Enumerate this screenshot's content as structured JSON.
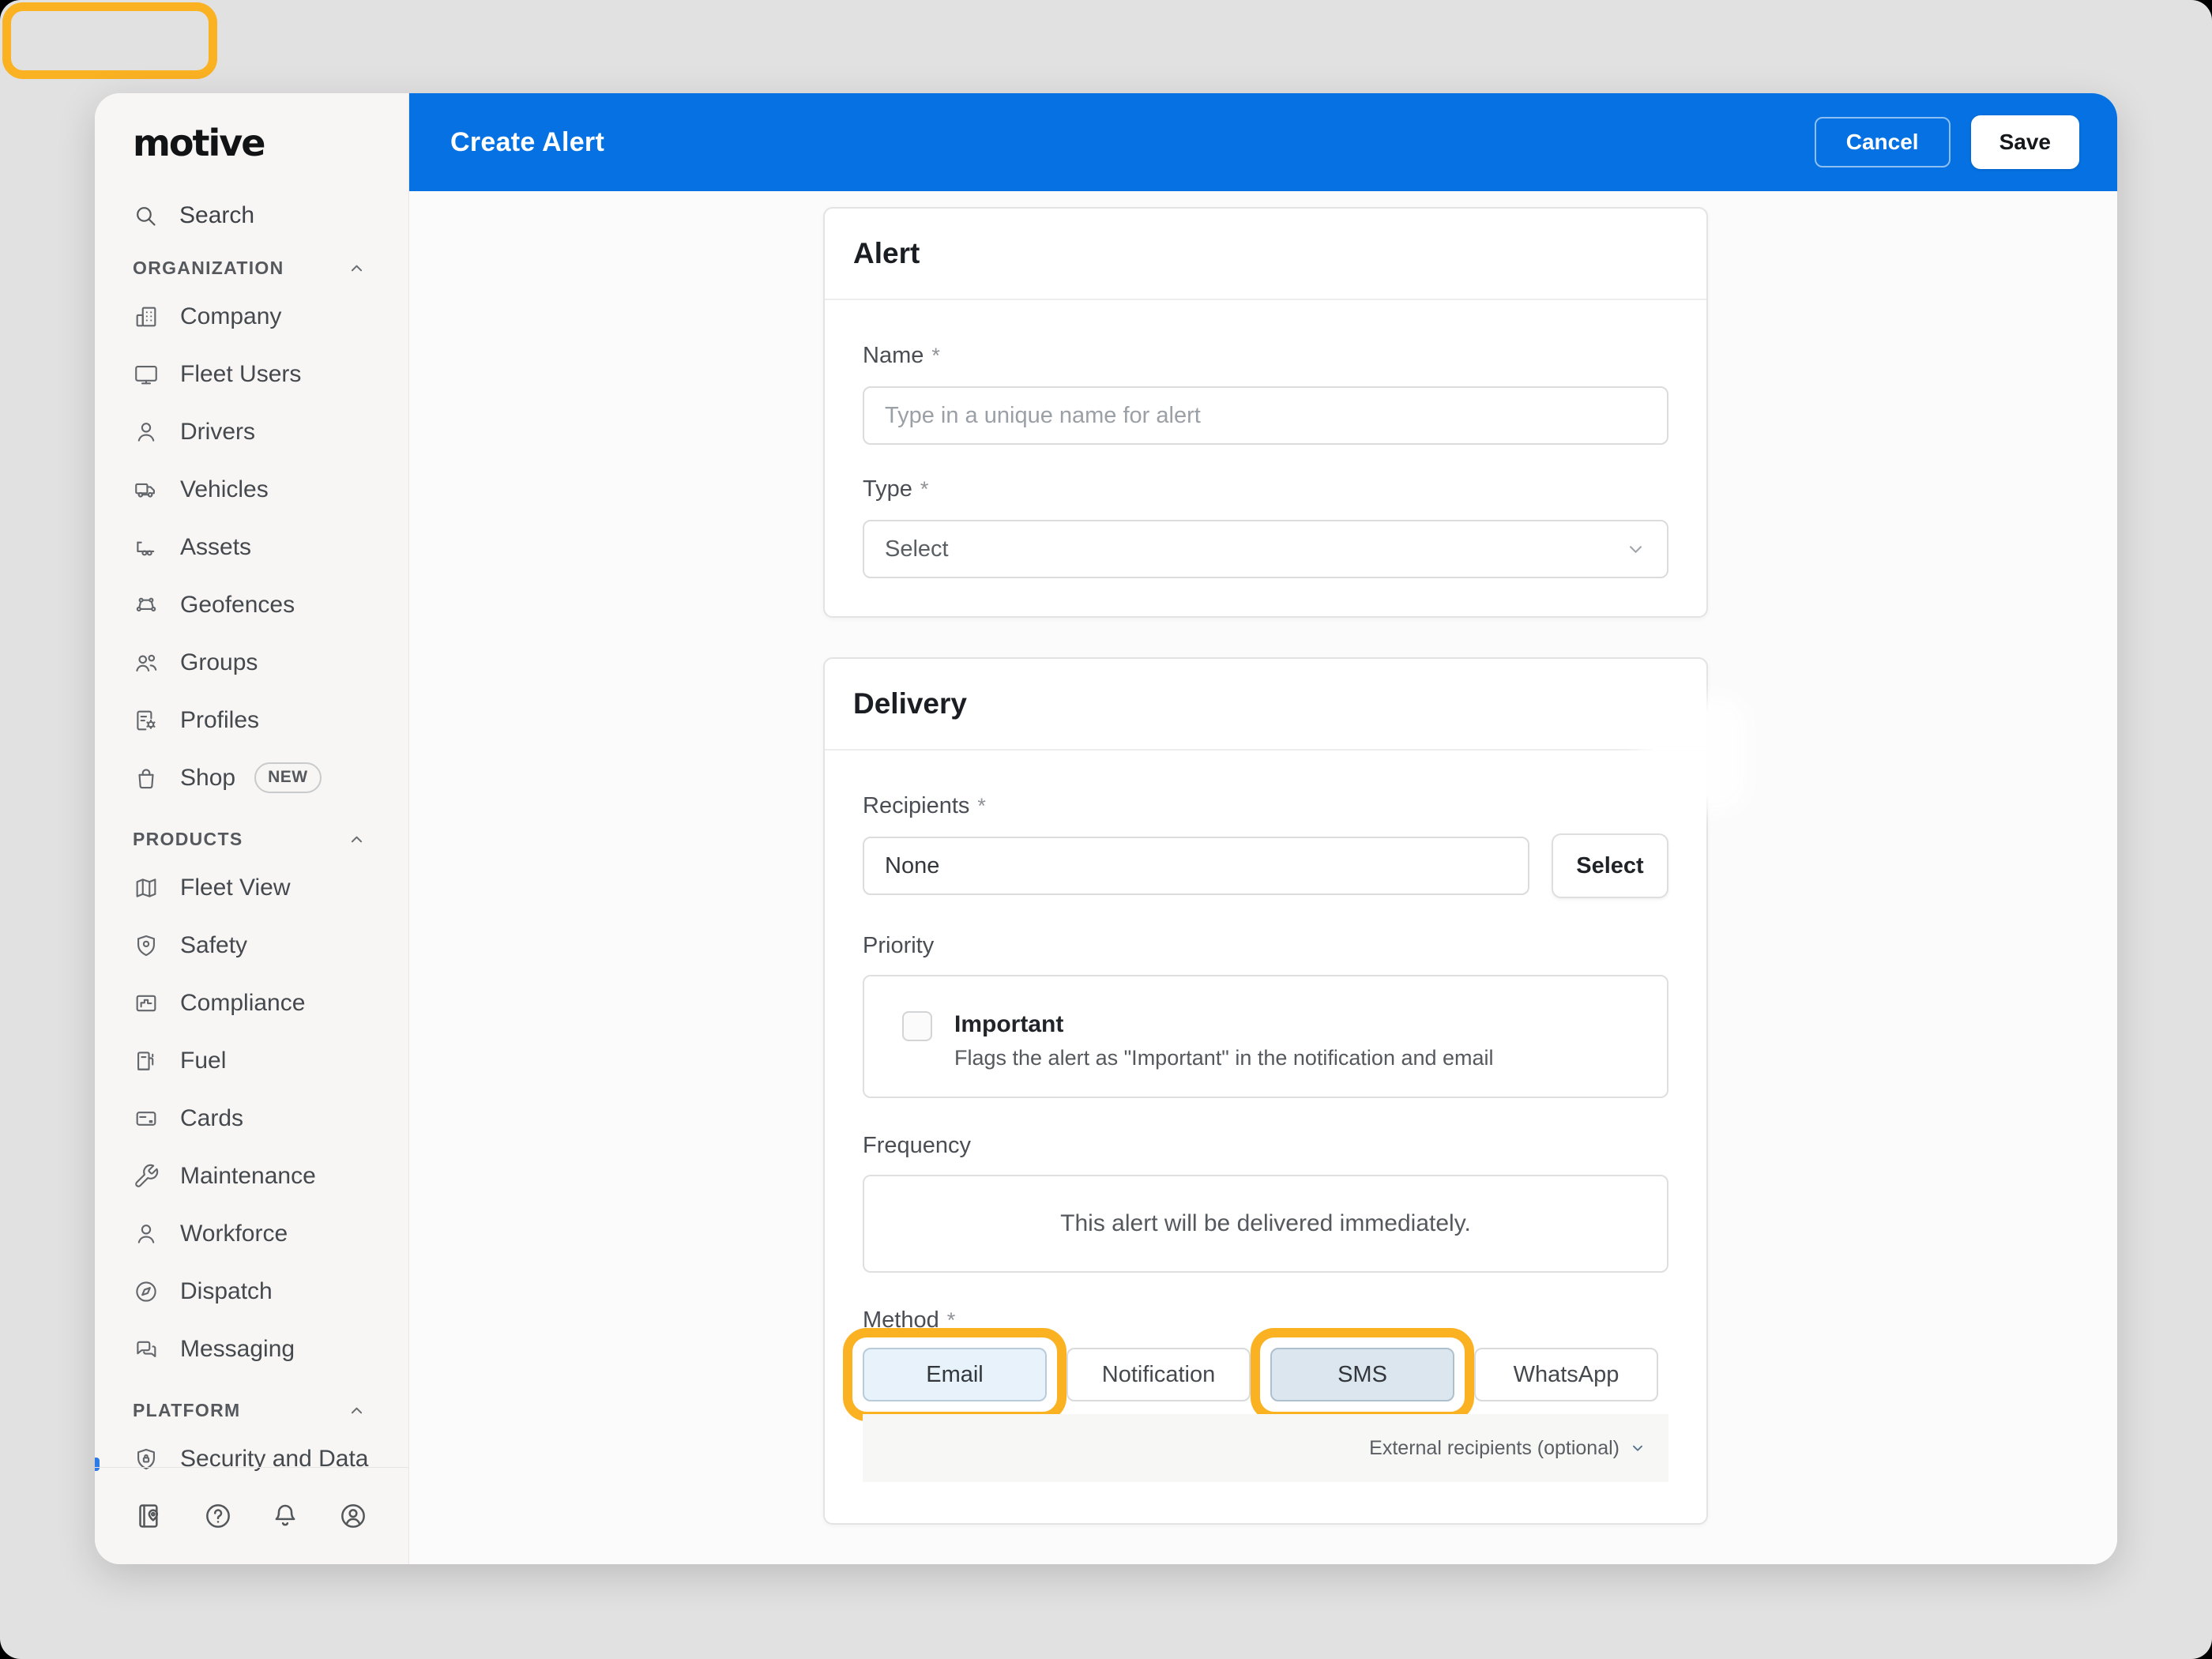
{
  "colors": {
    "header_blue": "#0571E2",
    "highlight_yellow": "#FAB122",
    "method_email_bg": "#E8F2FB",
    "method_sms_bg": "#DCE6EE"
  },
  "sidebar": {
    "logo_text": "motive",
    "search_label": "Search",
    "sections": [
      {
        "label": "ORGANIZATION",
        "items": [
          {
            "label": "Company",
            "icon": "building"
          },
          {
            "label": "Fleet Users",
            "icon": "monitor"
          },
          {
            "label": "Drivers",
            "icon": "person"
          },
          {
            "label": "Vehicles",
            "icon": "truck"
          },
          {
            "label": "Assets",
            "icon": "trailer"
          },
          {
            "label": "Geofences",
            "icon": "geofence"
          },
          {
            "label": "Groups",
            "icon": "people"
          },
          {
            "label": "Profiles",
            "icon": "profile-gear"
          },
          {
            "label": "Shop",
            "icon": "shopping-bag",
            "badge": "NEW"
          }
        ]
      },
      {
        "label": "PRODUCTS",
        "items": [
          {
            "label": "Fleet View",
            "icon": "map"
          },
          {
            "label": "Safety",
            "icon": "shield"
          },
          {
            "label": "Compliance",
            "icon": "step-chart"
          },
          {
            "label": "Fuel",
            "icon": "fuel-pump"
          },
          {
            "label": "Cards",
            "icon": "credit-card"
          },
          {
            "label": "Maintenance",
            "icon": "wrench"
          },
          {
            "label": "Workforce",
            "icon": "person"
          },
          {
            "label": "Dispatch",
            "icon": "compass"
          },
          {
            "label": "Messaging",
            "icon": "chat"
          }
        ]
      },
      {
        "label": "PLATFORM",
        "items": [
          {
            "label": "Security and Data",
            "icon": "shield-lock"
          }
        ]
      }
    ],
    "footer_icons": [
      "logbook",
      "help",
      "bell",
      "account"
    ]
  },
  "topbar": {
    "title": "Create Alert",
    "cancel_label": "Cancel",
    "save_label": "Save"
  },
  "alert_card": {
    "title": "Alert",
    "name_label": "Name",
    "name_required": "*",
    "name_placeholder": "Type in a unique name for alert",
    "type_label": "Type",
    "type_required": "*",
    "type_value": "Select"
  },
  "delivery_card": {
    "title": "Delivery",
    "recipients_label": "Recipients",
    "recipients_required": "*",
    "recipients_value": "None",
    "select_button_label": "Select",
    "priority_label": "Priority",
    "important_label": "Important",
    "important_description": "Flags the alert as \"Important\" in the notification and email",
    "frequency_label": "Frequency",
    "frequency_text": "This alert will be delivered immediately.",
    "method_label": "Method",
    "method_required": "*",
    "methods": [
      {
        "label": "Email",
        "state": "selected",
        "highlighted": true
      },
      {
        "label": "Notification",
        "state": "default",
        "highlighted": false
      },
      {
        "label": "SMS",
        "state": "selected-alt",
        "highlighted": true
      },
      {
        "label": "WhatsApp",
        "state": "default",
        "highlighted": false
      }
    ],
    "external_recipients_label": "External recipients (optional)"
  }
}
